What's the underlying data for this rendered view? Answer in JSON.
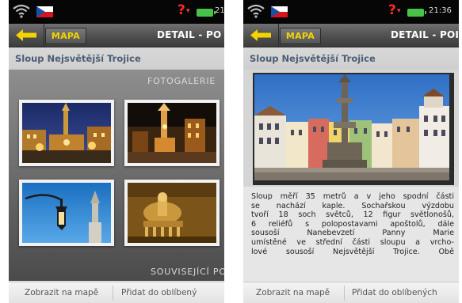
{
  "status_bar": {
    "time_left": "21:",
    "time_right": "21:36",
    "signal_icon": "signal-no-service-icon",
    "wifi_icon": "wifi-icon",
    "flag_icon": "czech-flag-icon",
    "battery_icon": "battery-icon"
  },
  "nav": {
    "back_icon": "back-arrow-icon",
    "map_label": "MAPA",
    "title_left": "DETAIL - PO",
    "title_right": "DETAIL - POI"
  },
  "poi": {
    "title": "Sloup Nejsvětější Trojice"
  },
  "left_screen": {
    "gallery_heading": "FOTOGALERIE",
    "related_heading": "SOUVISEJÍCÍ PO",
    "thumbnails": [
      {
        "name": "night-square-photo"
      },
      {
        "name": "illuminated-column-photo"
      },
      {
        "name": "lamp-and-tower-photo"
      },
      {
        "name": "baroque-sculpture-photo"
      }
    ]
  },
  "right_screen": {
    "photo": "holy-trinity-column-photo",
    "description_lines": [
      "Sloup měří 35 metrů a v jeho spodní části",
      "se nachází kaple. Sochařskou výzdobu",
      "tvoří 18 soch světců, 12 figur světlonošů,",
      "6 reliéfů s polopostavami apoštolů, dále",
      "sousoší Nanebevzetí Panny Marie",
      "umístěné ve střední části sloupu a vrcho-",
      "lové sousoší Nejsvětější Trojice. Obě"
    ]
  },
  "bottom_bar": {
    "show_on_map": "Zobrazit na mapě",
    "add_favorites_left": "Přidat do oblíbený",
    "add_favorites_right": "Přidat do oblíbených"
  },
  "colors": {
    "accent_yellow": "#f4d400",
    "title_blue": "#4b5d73",
    "status_warning": "#ff2a1f",
    "battery_green": "#49c24a"
  }
}
